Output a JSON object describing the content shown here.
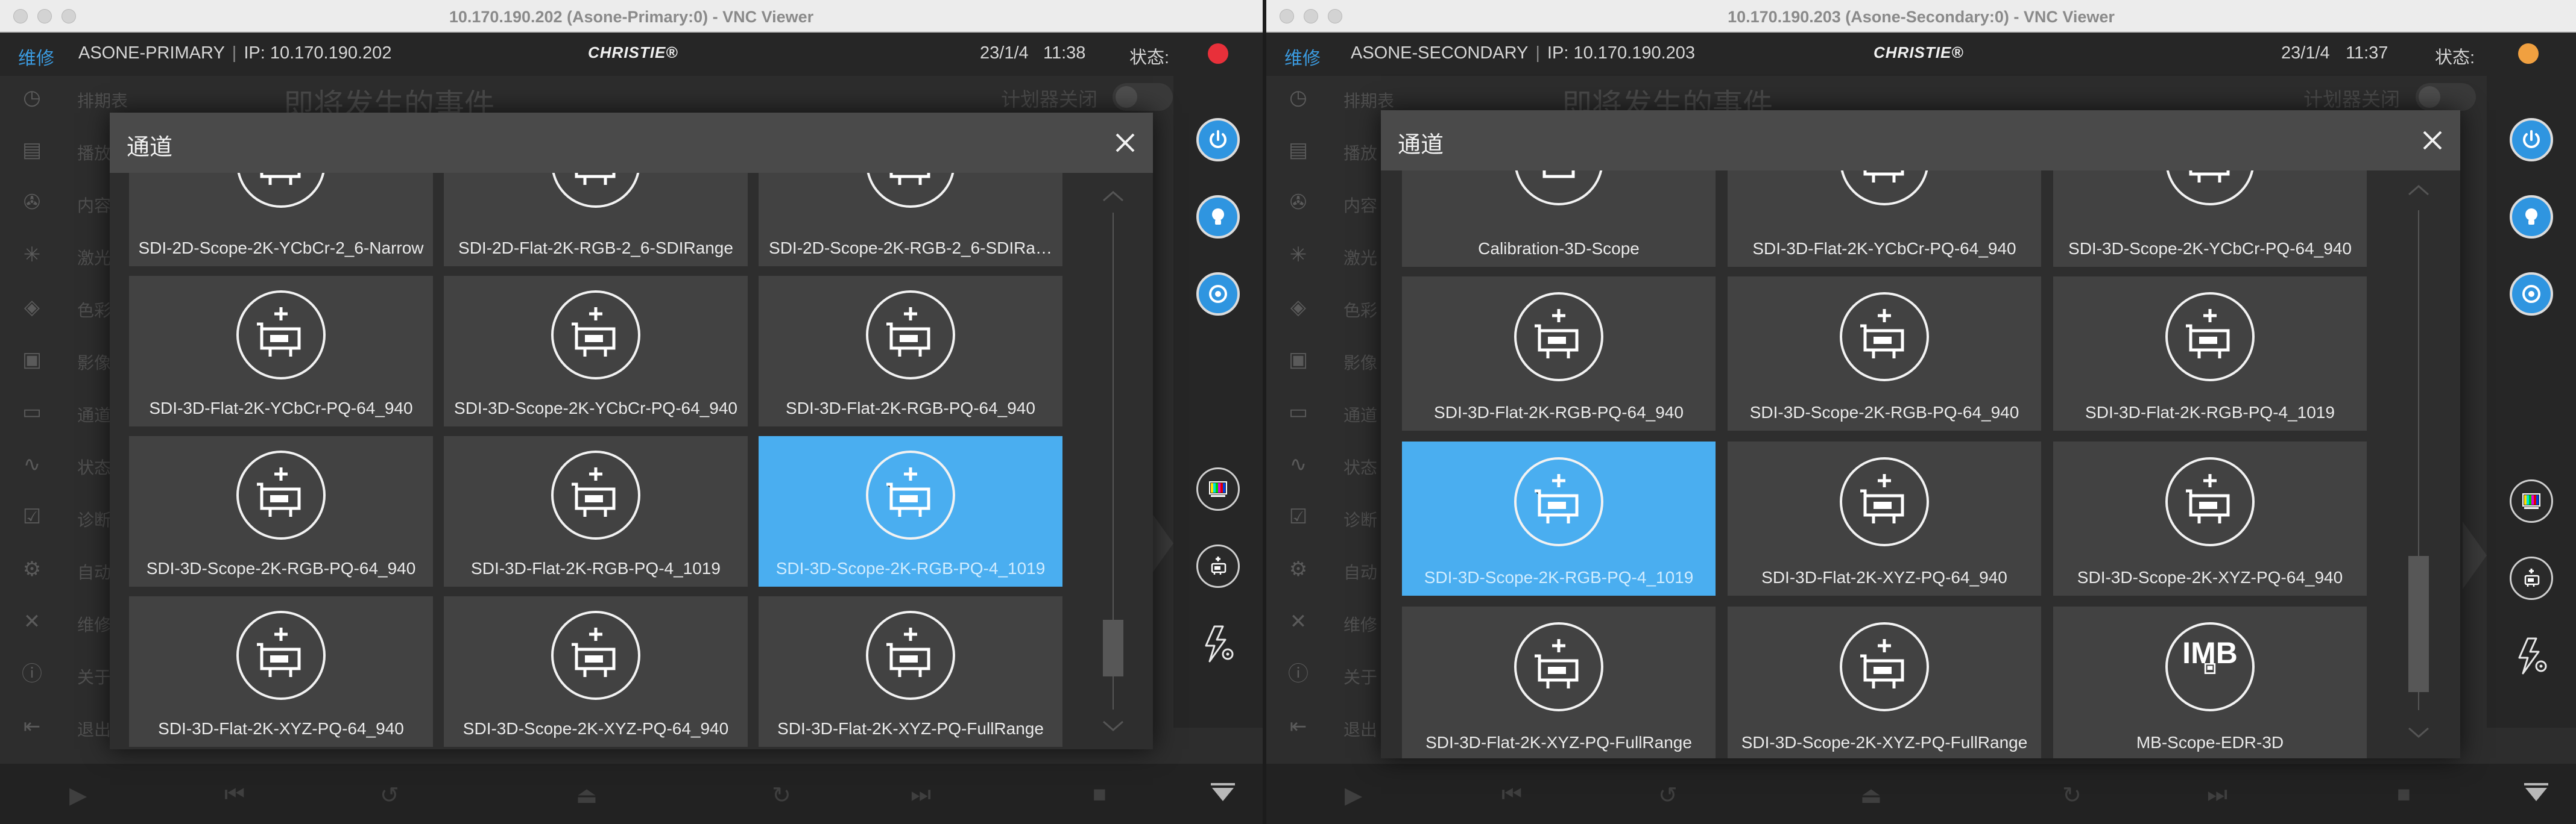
{
  "windows": [
    {
      "title": "10.170.190.202 (Asone-Primary:0) - VNC Viewer",
      "header": {
        "maintenance": "维修",
        "system_name": "ASONE-PRIMARY",
        "separator": "|",
        "ip": "IP: 10.170.190.202",
        "logo": "CHRISTIE®",
        "date": "23/1/4",
        "time": "11:38",
        "status_label": "状态:",
        "status_color": "#e8303a"
      },
      "events_title": "即将发生的事件",
      "scheduler_label": "计划器关闭",
      "sidebar": [
        "排期表",
        "播放",
        "内容",
        "激光",
        "色彩",
        "影像",
        "通道",
        "状态",
        "诊断",
        "自动",
        "维修",
        "关于",
        "退出"
      ],
      "modal": {
        "title": "通道",
        "tiles": [
          {
            "label": "SDI-2D-Scope-2K-YCbCr-2_6-Narrow",
            "icon": "sdi-card-icon"
          },
          {
            "label": "SDI-2D-Flat-2K-RGB-2_6-SDIRange",
            "icon": "sdi-card-icon"
          },
          {
            "label": "SDI-2D-Scope-2K-RGB-2_6-SDIRa…",
            "icon": "sdi-card-icon"
          },
          {
            "label": "SDI-3D-Flat-2K-YCbCr-PQ-64_940",
            "icon": "sdi-card-icon"
          },
          {
            "label": "SDI-3D-Scope-2K-YCbCr-PQ-64_940",
            "icon": "sdi-card-icon"
          },
          {
            "label": "SDI-3D-Flat-2K-RGB-PQ-64_940",
            "icon": "sdi-card-icon"
          },
          {
            "label": "SDI-3D-Scope-2K-RGB-PQ-64_940",
            "icon": "sdi-card-icon"
          },
          {
            "label": "SDI-3D-Flat-2K-RGB-PQ-4_1019",
            "icon": "sdi-card-icon"
          },
          {
            "label": "SDI-3D-Scope-2K-RGB-PQ-4_1019",
            "icon": "sdi-card-icon",
            "selected": true
          },
          {
            "label": "SDI-3D-Flat-2K-XYZ-PQ-64_940",
            "icon": "sdi-card-icon"
          },
          {
            "label": "SDI-3D-Scope-2K-XYZ-PQ-64_940",
            "icon": "sdi-card-icon"
          },
          {
            "label": "SDI-3D-Flat-2K-XYZ-PQ-FullRange",
            "icon": "sdi-card-icon"
          }
        ]
      }
    },
    {
      "title": "10.170.190.203 (Asone-Secondary:0) - VNC Viewer",
      "header": {
        "maintenance": "维修",
        "system_name": "ASONE-SECONDARY",
        "separator": "|",
        "ip": "IP: 10.170.190.203",
        "logo": "CHRISTIE®",
        "date": "23/1/4",
        "time": "11:37",
        "status_label": "状态:",
        "status_color": "#f0a040"
      },
      "events_title": "即将发生的事件",
      "scheduler_label": "计划器关闭",
      "sidebar": [
        "排期表",
        "播放",
        "内容",
        "激光",
        "色彩",
        "影像",
        "通道",
        "状态",
        "诊断",
        "自动",
        "维修",
        "关于",
        "退出"
      ],
      "modal": {
        "title": "通道",
        "tiles": [
          {
            "label": "Calibration-3D-Scope",
            "icon": "network-card-icon"
          },
          {
            "label": "SDI-3D-Flat-2K-YCbCr-PQ-64_940",
            "icon": "sdi-card-icon"
          },
          {
            "label": "SDI-3D-Scope-2K-YCbCr-PQ-64_940",
            "icon": "sdi-card-icon"
          },
          {
            "label": "SDI-3D-Flat-2K-RGB-PQ-64_940",
            "icon": "sdi-card-icon"
          },
          {
            "label": "SDI-3D-Scope-2K-RGB-PQ-64_940",
            "icon": "sdi-card-icon"
          },
          {
            "label": "SDI-3D-Flat-2K-RGB-PQ-4_1019",
            "icon": "sdi-card-icon"
          },
          {
            "label": "SDI-3D-Scope-2K-RGB-PQ-4_1019",
            "icon": "sdi-card-icon",
            "selected": true
          },
          {
            "label": "SDI-3D-Flat-2K-XYZ-PQ-64_940",
            "icon": "sdi-card-icon"
          },
          {
            "label": "SDI-3D-Scope-2K-XYZ-PQ-64_940",
            "icon": "sdi-card-icon"
          },
          {
            "label": "SDI-3D-Flat-2K-XYZ-PQ-FullRange",
            "icon": "sdi-card-icon"
          },
          {
            "label": "SDI-3D-Scope-2K-XYZ-PQ-FullRange",
            "icon": "sdi-card-icon"
          },
          {
            "label": "MB-Scope-EDR-3D",
            "icon": "imb-card-icon",
            "icon_text": "IMB"
          }
        ]
      }
    }
  ]
}
